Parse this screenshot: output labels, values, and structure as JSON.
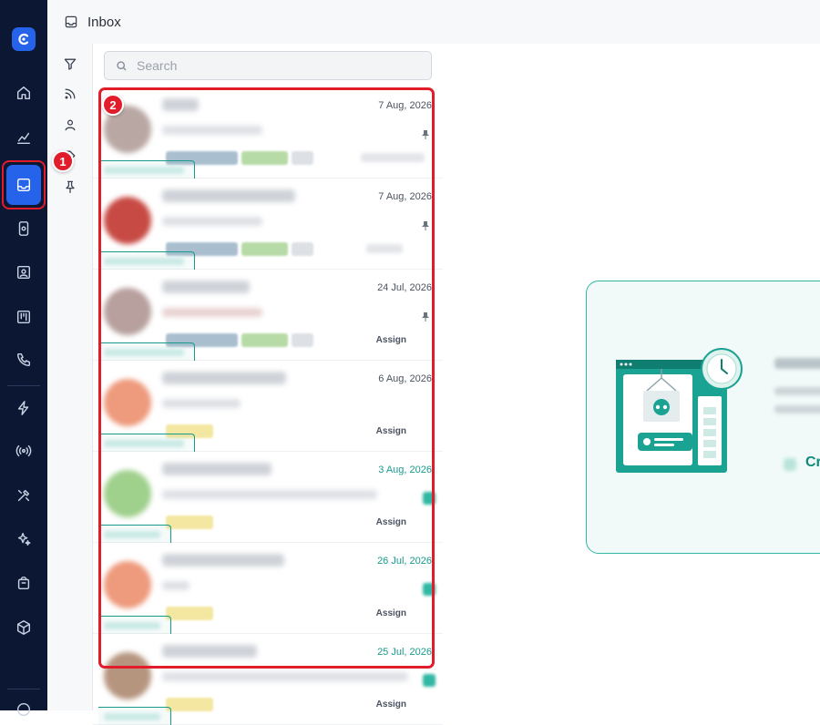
{
  "header": {
    "title": "Inbox"
  },
  "search": {
    "placeholder": "Search"
  },
  "annotations": {
    "badge1": "1",
    "badge2": "2"
  },
  "conversations": [
    {
      "date": "7 Aug, 2026",
      "date_color": "default",
      "pinned": true,
      "assign": "",
      "avatar_color": "#b9a7a3",
      "chips": [
        "#a9bfcf",
        "#b7dba7",
        "#dde0e5"
      ]
    },
    {
      "date": "7 Aug, 2026",
      "date_color": "default",
      "pinned": true,
      "assign": "",
      "avatar_color": "#c84a44",
      "chips": [
        "#a9bfcf",
        "#b7dba7",
        "#dde0e5"
      ]
    },
    {
      "date": "24 Jul, 2026",
      "date_color": "default",
      "pinned": true,
      "assign": "Assign",
      "avatar_color": "#b7a09d",
      "chips": [
        "#a9bfcf",
        "#b7dba7",
        "#dde0e5"
      ]
    },
    {
      "date": "6 Aug, 2026",
      "date_color": "default",
      "pinned": false,
      "assign": "Assign",
      "avatar_color": "#ee9a7c",
      "chips": [
        "#f4e7a1"
      ]
    },
    {
      "date": "3 Aug, 2026",
      "date_color": "teal",
      "pinned": false,
      "assign": "Assign",
      "avatar_color": "#9fd08c",
      "chips": [
        "#f4e7a1"
      ]
    },
    {
      "date": "26 Jul, 2026",
      "date_color": "teal",
      "pinned": false,
      "assign": "Assign",
      "avatar_color": "#ee9a7c",
      "chips": [
        "#f4e7a1"
      ]
    },
    {
      "date": "25 Jul, 2026",
      "date_color": "teal",
      "pinned": false,
      "assign": "Assign",
      "avatar_color": "#b6957f",
      "chips": [
        "#f4e7a1"
      ]
    }
  ],
  "empty_state": {
    "cta": "Cr"
  },
  "colors": {
    "rail": "#0b1733",
    "accent": "#2563eb",
    "teal": "#179a8c",
    "highlight": "#e11d2b"
  }
}
